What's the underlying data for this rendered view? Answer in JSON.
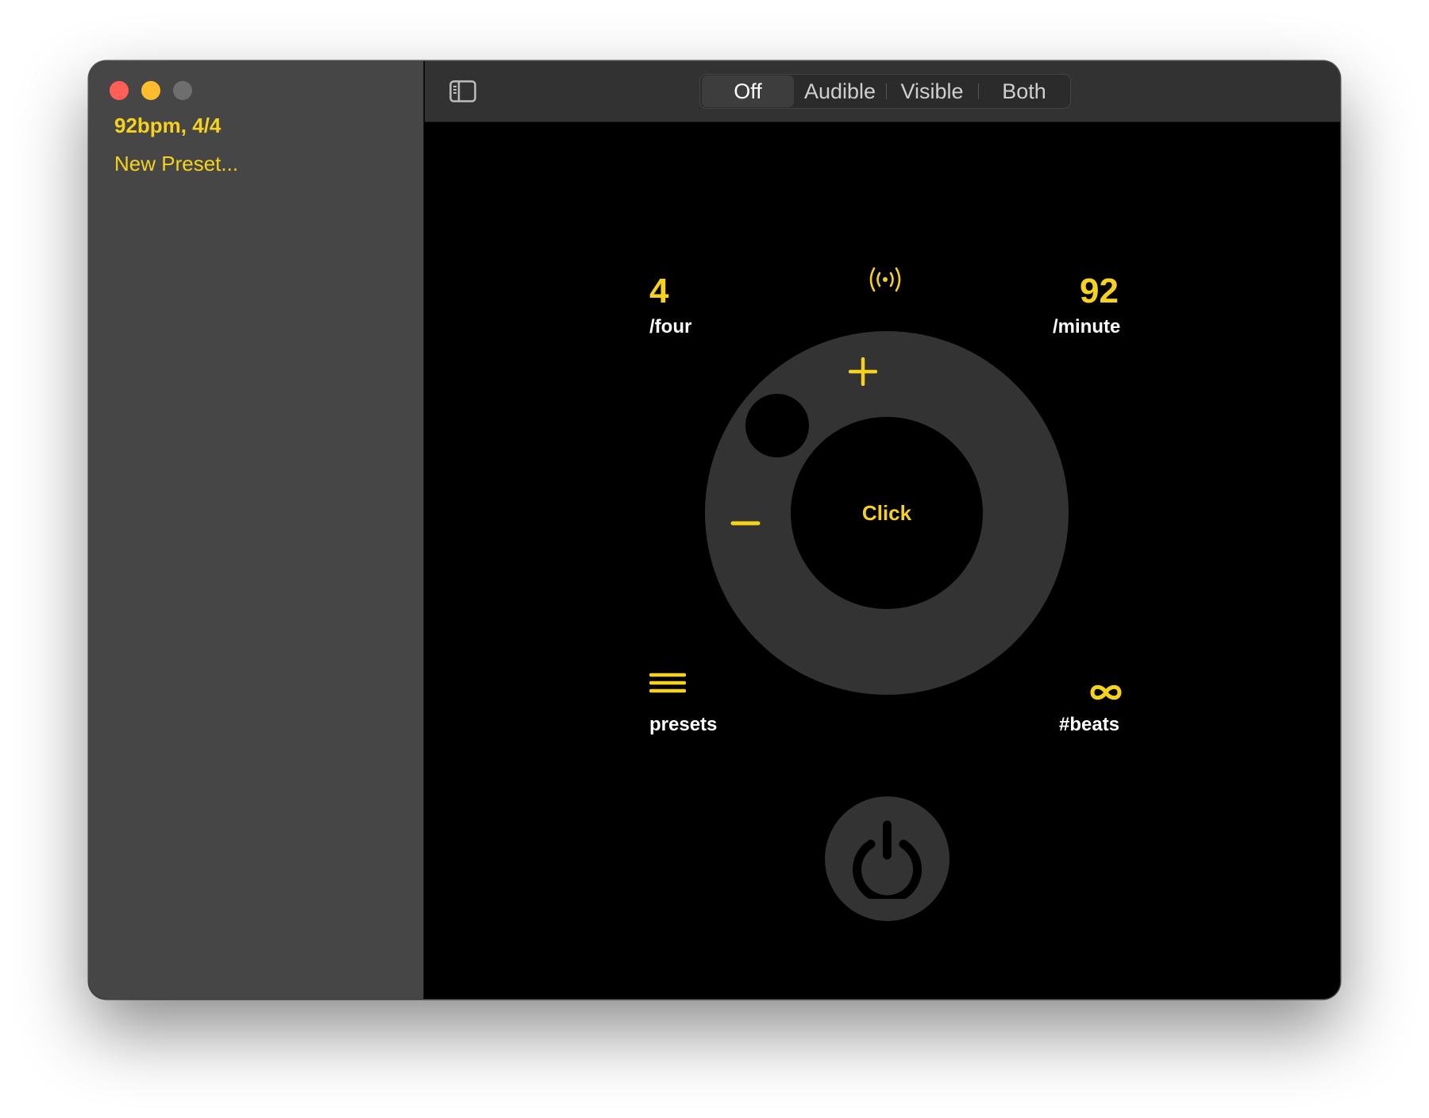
{
  "window": {
    "controls": [
      "close",
      "minimize",
      "zoom"
    ]
  },
  "sidebar": {
    "items": [
      {
        "label": "92bpm, 4/4"
      },
      {
        "label": "New Preset..."
      }
    ]
  },
  "toolbar": {
    "toggle_icon": "sidebar-toggle-icon",
    "modes": [
      {
        "label": "Off",
        "selected": true
      },
      {
        "label": "Audible",
        "selected": false
      },
      {
        "label": "Visible",
        "selected": false
      },
      {
        "label": "Both",
        "selected": false
      }
    ]
  },
  "metronome": {
    "signature": {
      "value": "4",
      "label": "/four"
    },
    "tempo": {
      "value": "92",
      "label": "/minute"
    },
    "broadcast_icon": "broadcast-icon",
    "dial": {
      "center_label": "Click",
      "plus_icon": "plus-icon",
      "minus_icon": "minus-icon"
    },
    "presets": {
      "icon": "menu-icon",
      "label": "presets"
    },
    "beats": {
      "icon": "infinity-icon",
      "label": "#beats"
    },
    "power_icon": "power-icon"
  },
  "colors": {
    "accent": "#f6d21f",
    "sidebar_bg": "#464646",
    "toolbar_bg": "#323232",
    "dial_bg": "#333333",
    "main_bg": "#000000"
  }
}
